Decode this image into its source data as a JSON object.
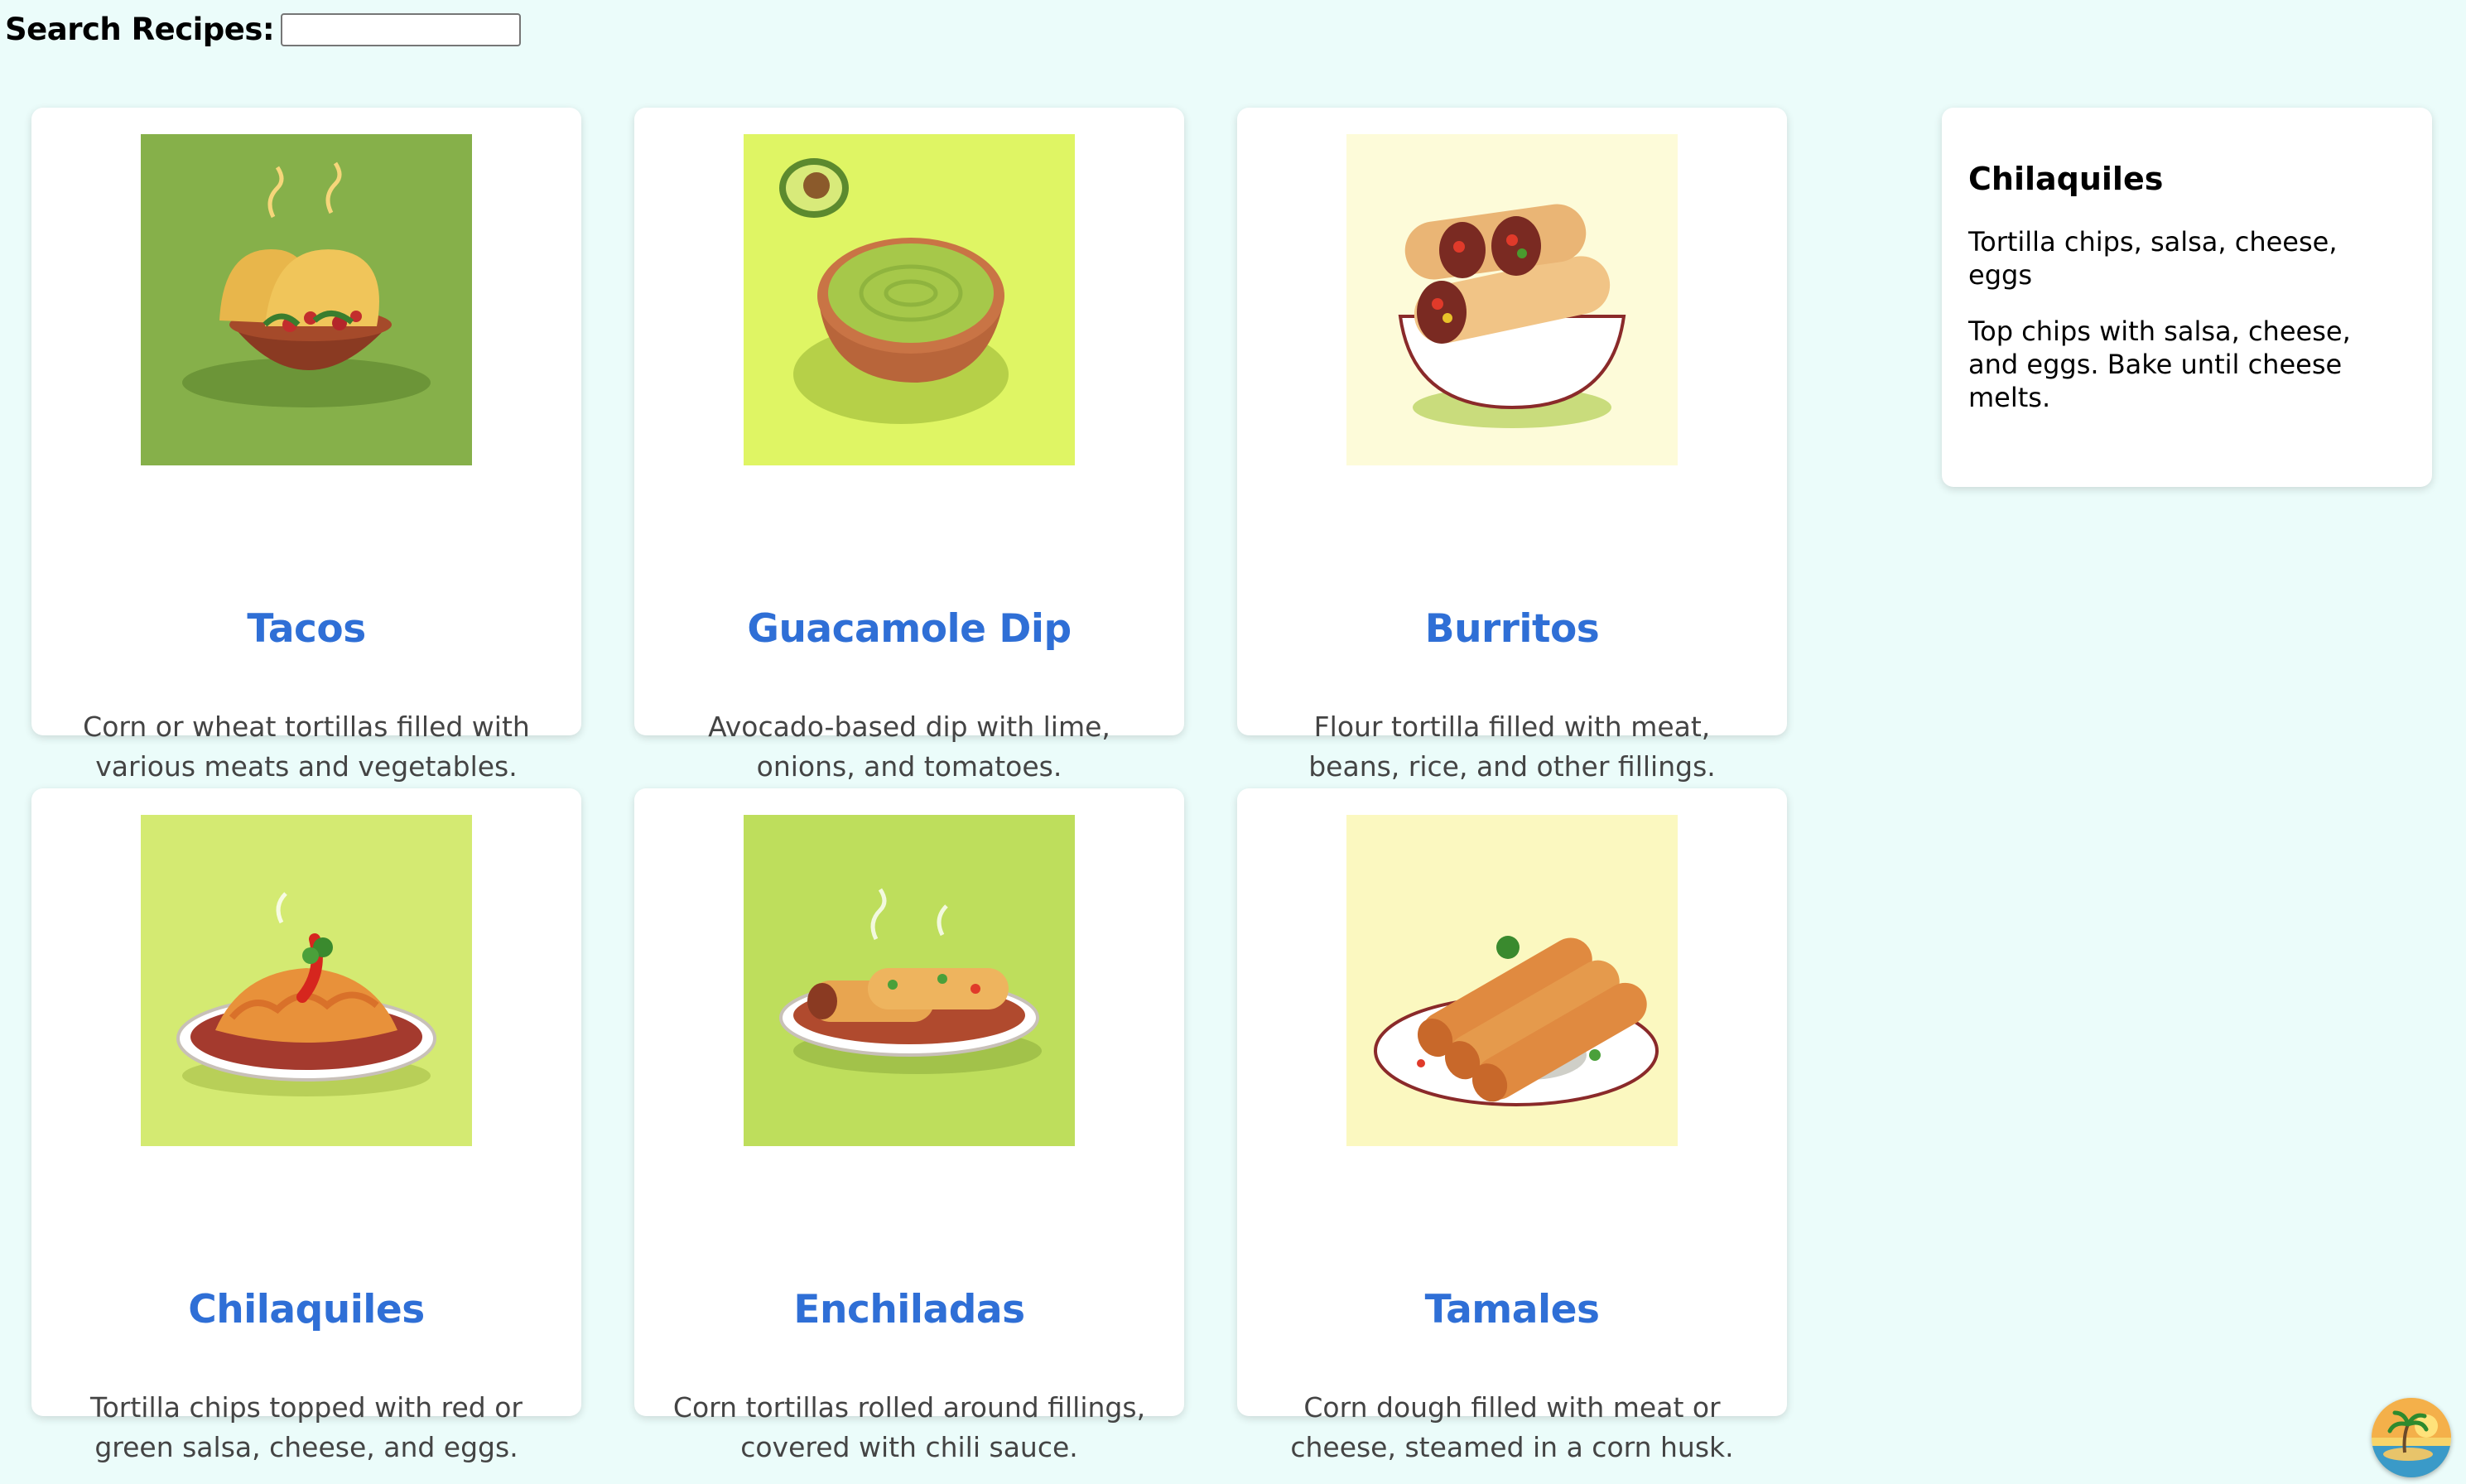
{
  "search": {
    "label": "Search Recipes",
    "colon": ":",
    "value": "",
    "placeholder": ""
  },
  "recipes": [
    {
      "title": "Tacos",
      "description": "Corn or wheat tortillas filled with various meats and vegetables.",
      "image_icon": "tacos-illustration",
      "image_bg": "#86b04a"
    },
    {
      "title": "Guacamole Dip",
      "description": "Avocado-based dip with lime, onions, and tomatoes.",
      "image_icon": "guacamole-illustration",
      "image_bg": "#dff564"
    },
    {
      "title": "Burritos",
      "description": "Flour tortilla filled with meat, beans, rice, and other fillings.",
      "image_icon": "burrito-illustration",
      "image_bg": "#fdfbd9"
    },
    {
      "title": "Chilaquiles",
      "description": "Tortilla chips topped with red or green salsa, cheese, and eggs.",
      "image_icon": "chilaquiles-illustration",
      "image_bg": "#d4ea72"
    },
    {
      "title": "Enchiladas",
      "description": "Corn tortillas rolled around fillings, covered with chili sauce.",
      "image_icon": "enchiladas-illustration",
      "image_bg": "#bede5c"
    },
    {
      "title": "Tamales",
      "description": "Corn dough filled with meat or cheese, steamed in a corn husk.",
      "image_icon": "tamales-illustration",
      "image_bg": "#fbf8c0"
    }
  ],
  "detail": {
    "title": "Chilaquiles",
    "ingredients": "Tortilla chips, salsa, cheese, eggs",
    "instructions": "Top chips with salsa, cheese, and eggs. Bake until cheese melts."
  },
  "colors": {
    "page_bg": "#ebfcfa",
    "title_blue": "#2f6fd6",
    "desc_gray": "#444444"
  },
  "logo_icon": "beach-palm-logo-icon"
}
